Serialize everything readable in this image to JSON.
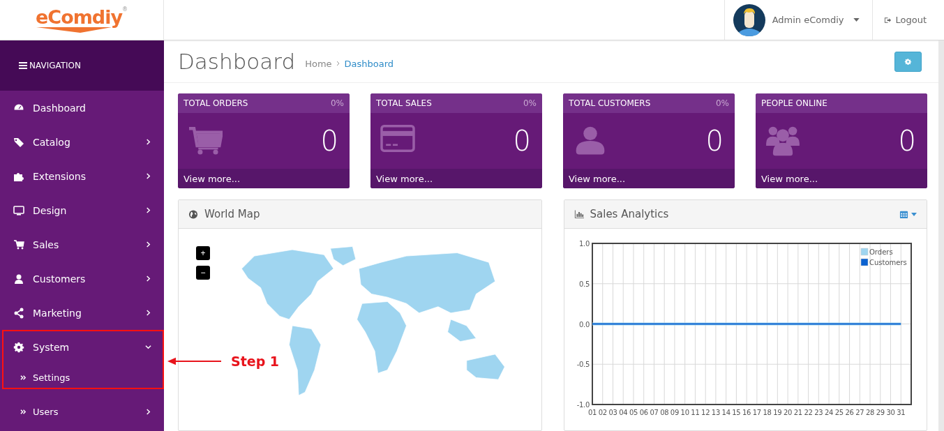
{
  "header": {
    "logo": "eComdiy",
    "logo_mark": "®",
    "user": "Admin eComdiy",
    "logout": "Logout"
  },
  "sidebar": {
    "title": "NAVIGATION",
    "items": [
      {
        "label": "Dashboard",
        "kind": "link"
      },
      {
        "label": "Catalog",
        "kind": "menu",
        "expanded": false
      },
      {
        "label": "Extensions",
        "kind": "menu",
        "expanded": false
      },
      {
        "label": "Design",
        "kind": "menu",
        "expanded": false
      },
      {
        "label": "Sales",
        "kind": "menu",
        "expanded": false
      },
      {
        "label": "Customers",
        "kind": "menu",
        "expanded": false
      },
      {
        "label": "Marketing",
        "kind": "menu",
        "expanded": false
      },
      {
        "label": "System",
        "kind": "menu",
        "expanded": true,
        "children": [
          {
            "label": "Settings",
            "kind": "link"
          },
          {
            "label": "Users",
            "kind": "menu",
            "expanded": false
          }
        ]
      }
    ]
  },
  "annotation": {
    "label": "Step 1"
  },
  "page": {
    "title": "Dashboard",
    "breadcrumb": [
      {
        "label": "Home"
      },
      {
        "label": "Dashboard"
      }
    ]
  },
  "stats": [
    {
      "title": "TOTAL ORDERS",
      "percent": "0%",
      "value": "0",
      "link": "View more..."
    },
    {
      "title": "TOTAL SALES",
      "percent": "0%",
      "value": "0",
      "link": "View more..."
    },
    {
      "title": "TOTAL CUSTOMERS",
      "percent": "0%",
      "value": "0",
      "link": "View more..."
    },
    {
      "title": "PEOPLE ONLINE",
      "value": "0",
      "link": "View more..."
    }
  ],
  "world_map": {
    "title": "World Map",
    "zoom_in": "+",
    "zoom_out": "−"
  },
  "sales_analytics": {
    "title": "Sales Analytics",
    "chart_data": {
      "type": "line",
      "categories": [
        "01",
        "02",
        "03",
        "04",
        "05",
        "06",
        "07",
        "08",
        "09",
        "10",
        "11",
        "12",
        "13",
        "14",
        "15",
        "16",
        "17",
        "18",
        "19",
        "20",
        "21",
        "22",
        "23",
        "24",
        "25",
        "26",
        "27",
        "28",
        "29",
        "30",
        "31"
      ],
      "series": [
        {
          "name": "Orders",
          "color": "#9fd5f0",
          "values": [
            0,
            0,
            0,
            0,
            0,
            0,
            0,
            0,
            0,
            0,
            0,
            0,
            0,
            0,
            0,
            0,
            0,
            0,
            0,
            0,
            0,
            0,
            0,
            0,
            0,
            0,
            0,
            0,
            0,
            0,
            0
          ]
        },
        {
          "name": "Customers",
          "color": "#0b62d0",
          "values": [
            0,
            0,
            0,
            0,
            0,
            0,
            0,
            0,
            0,
            0,
            0,
            0,
            0,
            0,
            0,
            0,
            0,
            0,
            0,
            0,
            0,
            0,
            0,
            0,
            0,
            0,
            0,
            0,
            0,
            0,
            0
          ]
        }
      ],
      "ylim": [
        -1,
        1
      ],
      "grid": true,
      "legend": true,
      "yticks": [
        {
          "value": -1,
          "label": "-1.0"
        },
        {
          "value": -0.5,
          "label": "-0.5"
        },
        {
          "value": 0,
          "label": "0.0"
        },
        {
          "value": 0.5,
          "label": "0.5"
        },
        {
          "value": 1,
          "label": "1.0"
        }
      ]
    }
  }
}
